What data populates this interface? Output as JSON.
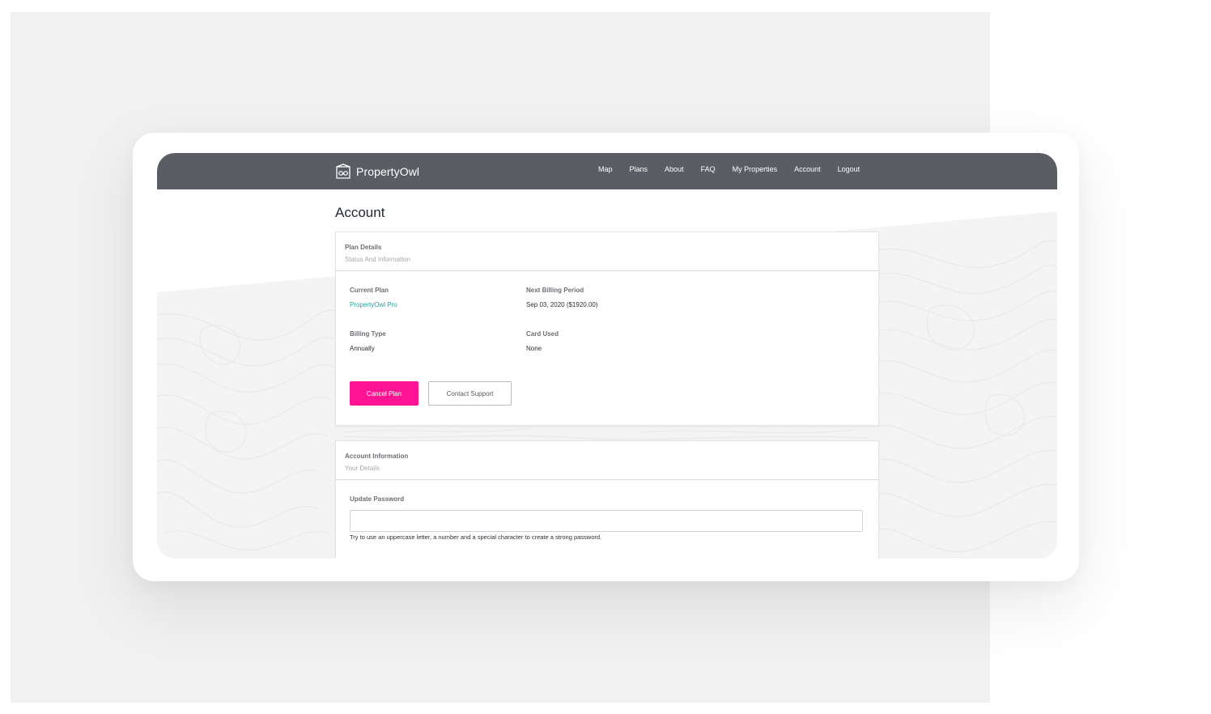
{
  "brand": {
    "name": "PropertyOwl",
    "logo_icon": "owl-logo-icon"
  },
  "nav": {
    "items": [
      {
        "label": "Map"
      },
      {
        "label": "Plans"
      },
      {
        "label": "About"
      },
      {
        "label": "FAQ"
      },
      {
        "label": "My Properties"
      },
      {
        "label": "Account"
      },
      {
        "label": "Logout"
      }
    ]
  },
  "page": {
    "title": "Account"
  },
  "plan_details": {
    "title": "Plan Details",
    "subtitle": "Status And Information",
    "current_plan_label": "Current Plan",
    "current_plan_value": "PropertyOwl Pro",
    "next_billing_label": "Next Billing Period",
    "next_billing_value": "Sep 03, 2020 ($1920.00)",
    "billing_type_label": "Billing Type",
    "billing_type_value": "Annually",
    "card_used_label": "Card Used",
    "card_used_value": "None",
    "cancel_button": "Cancel Plan",
    "support_button": "Contact Support"
  },
  "account_info": {
    "title": "Account Information",
    "subtitle": "Your Details",
    "password_label": "Update Password",
    "password_value": "",
    "password_hint": "Try to use an uppercase letter, a number and a special character to create a strong password."
  },
  "colors": {
    "navbar": "#5a5d63",
    "accent_pink": "#ff1493",
    "link_teal": "#1aa8a0",
    "background_grey": "#f1f1f1"
  }
}
